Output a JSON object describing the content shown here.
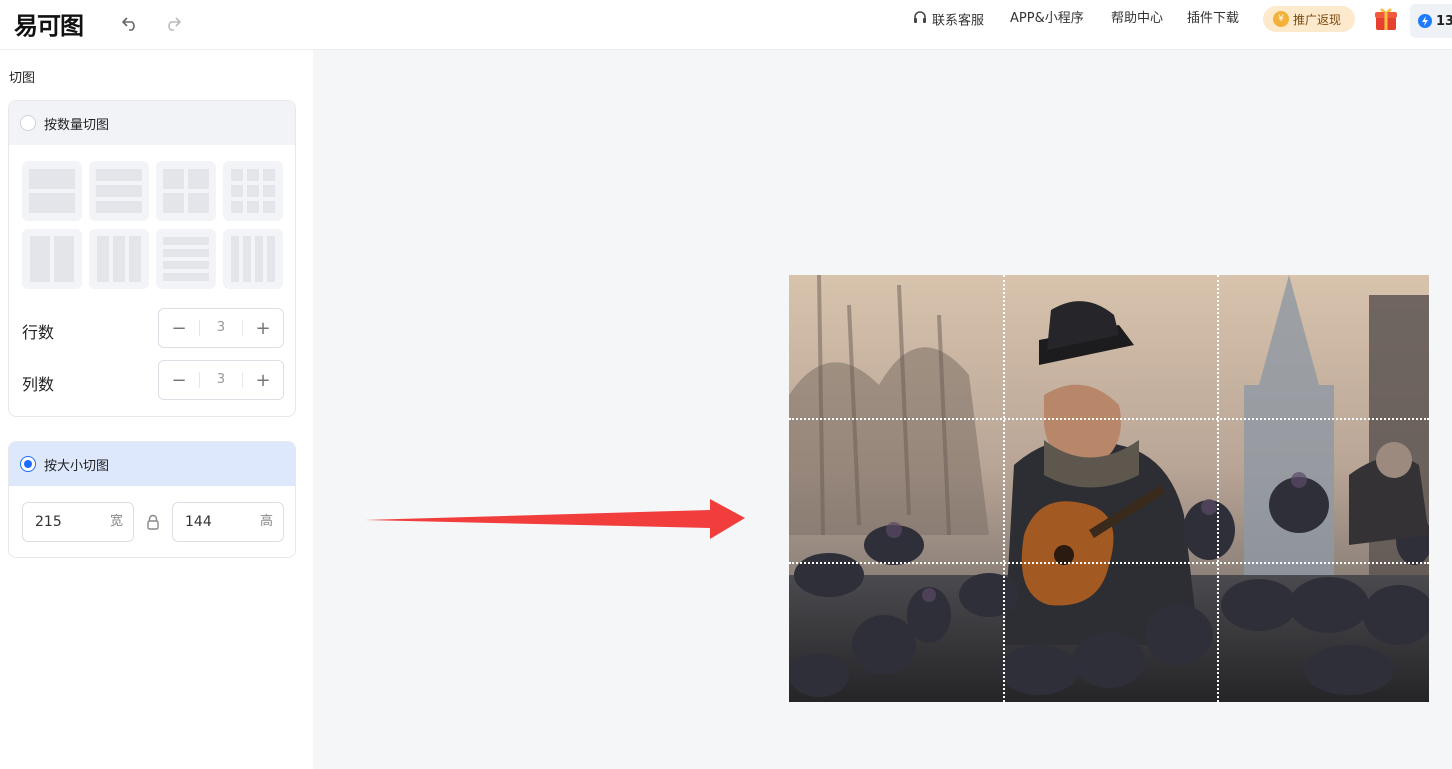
{
  "header": {
    "logo": "易可图",
    "undo_icon": "undo-icon",
    "redo_icon": "redo-icon",
    "nav": [
      {
        "label": "联系客服",
        "icon": "headset-icon"
      },
      {
        "label": "APP&小程序"
      },
      {
        "label": "帮助中心"
      },
      {
        "label": "插件下载"
      }
    ],
    "promo_label": "推广返现",
    "credit_value": "13"
  },
  "sidebar": {
    "title": "切图",
    "by_count": {
      "label": "按数量切图",
      "selected": false,
      "rows_label": "行数",
      "rows_value": "3",
      "cols_label": "列数",
      "cols_value": "3"
    },
    "by_size": {
      "label": "按大小切图",
      "selected": true,
      "width_value": "215",
      "width_unit": "宽",
      "height_value": "144",
      "height_unit": "高"
    }
  },
  "canvas": {
    "arrow_color": "#f23d3d",
    "grid_rows": 3,
    "grid_cols": 3
  },
  "colors": {
    "accent": "#1e6cff",
    "panel_bg": "#f5f6f8"
  }
}
